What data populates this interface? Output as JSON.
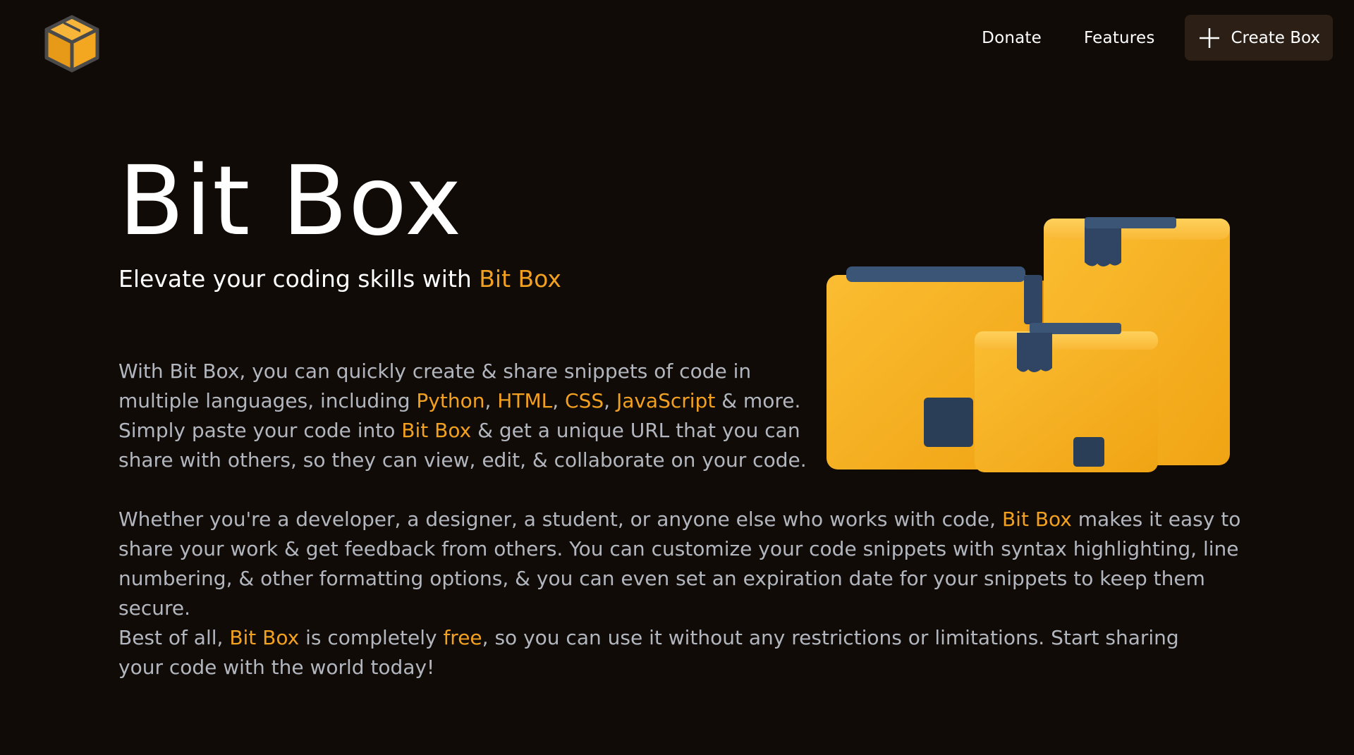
{
  "header": {
    "nav": {
      "donate": "Donate",
      "features": "Features",
      "create_box": "Create Box"
    }
  },
  "hero": {
    "title": "Bit Box",
    "tagline_prefix": "Elevate your coding skills with ",
    "tagline_accent": "Bit Box"
  },
  "paragraph1": {
    "t1": "With Bit Box, you can quickly create & share snippets of code in multiple languages, including ",
    "lang1": "Python",
    "sep1": ", ",
    "lang2": "HTML",
    "sep2": ", ",
    "lang3": "CSS",
    "sep3": ", ",
    "lang4": "JavaScript",
    "t2": " & more. Simply paste your code into ",
    "accent": "Bit Box",
    "t3": " & get a unique URL that you can share with others, so they can view, edit, & collaborate on your code."
  },
  "paragraph2": {
    "t1": "Whether you're a developer, a designer, a student, or anyone else who works with code, ",
    "accent": "Bit Box",
    "t2": " makes it easy to share your work & get feedback from others. You can customize your code snippets with syntax highlighting, line numbering, & other formatting options, & you can even set an expiration date for your snippets to keep them secure."
  },
  "paragraph3": {
    "t1": "Best of all, ",
    "accent1": "Bit Box",
    "t2": " is completely ",
    "accent2": "free",
    "t3": ", so you can use it without any restrictions or limitations. Start sharing your code with the world today!"
  },
  "icons": {
    "logo": "cube-logo-icon",
    "plus": "plus-icon",
    "illustration": "cardboard-boxes-illustration"
  },
  "colors": {
    "background": "#110b07",
    "accent": "#f2a01f",
    "body_text": "#b2b6be",
    "button_bg": "#2c2016",
    "box_tape": "#2f4563"
  }
}
